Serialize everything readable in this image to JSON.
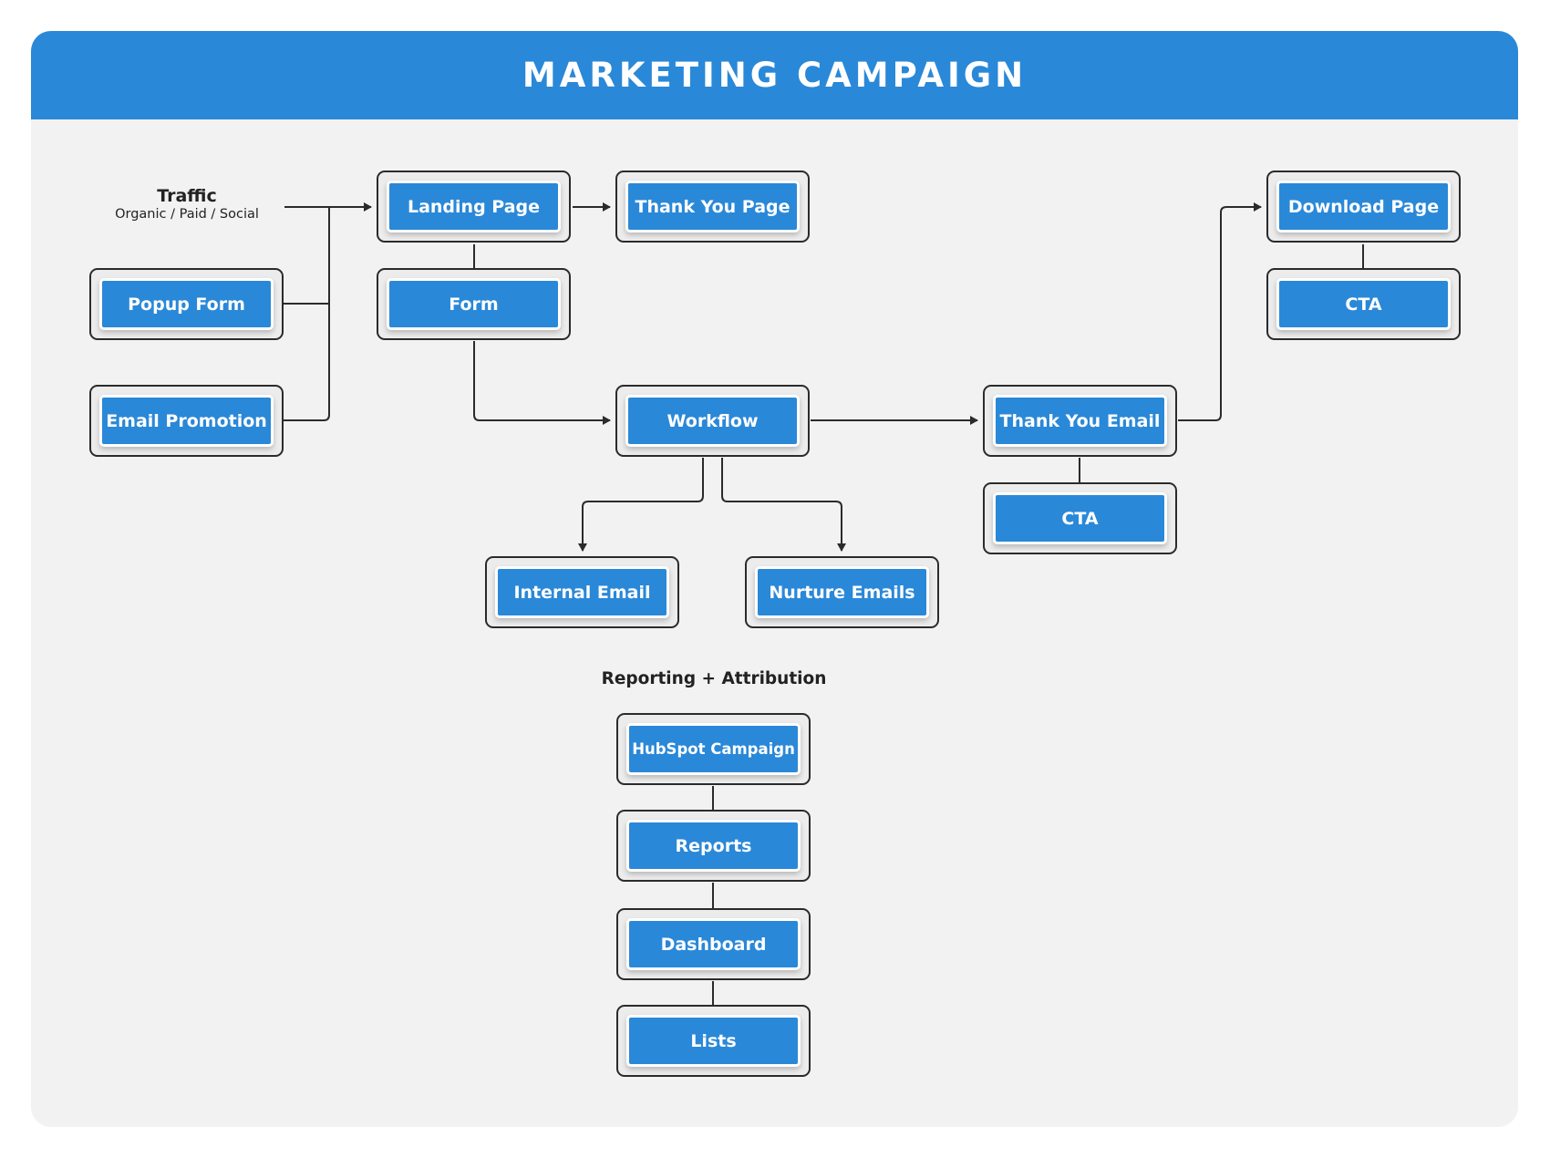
{
  "header": {
    "title": "MARKETING CAMPAIGN"
  },
  "traffic": {
    "title": "Traffic",
    "subtitle": "Organic / Paid / Social"
  },
  "reporting": {
    "label": "Reporting + Attribution"
  },
  "nodes": {
    "landing_page": "Landing Page",
    "thank_you_page": "Thank You Page",
    "popup_form": "Popup Form",
    "form": "Form",
    "email_promotion": "Email Promotion",
    "workflow": "Workflow",
    "thank_you_email": "Thank You Email",
    "cta_email": "CTA",
    "download_page": "Download Page",
    "cta_download": "CTA",
    "internal_email": "Internal Email",
    "nurture_emails": "Nurture Emails",
    "hubspot_campaign": "HubSpot Campaign",
    "reports": "Reports",
    "dashboard": "Dashboard",
    "lists": "Lists"
  },
  "edges": [
    {
      "from": "traffic",
      "to": "landing_page",
      "arrow": true
    },
    {
      "from": "popup_form",
      "to": "landing_page",
      "arrow": true
    },
    {
      "from": "email_promotion",
      "to": "landing_page",
      "arrow": true
    },
    {
      "from": "landing_page",
      "to": "thank_you_page",
      "arrow": true
    },
    {
      "from": "landing_page",
      "to": "form",
      "arrow": false
    },
    {
      "from": "form",
      "to": "workflow",
      "arrow": true
    },
    {
      "from": "workflow",
      "to": "thank_you_email",
      "arrow": true
    },
    {
      "from": "workflow",
      "to": "internal_email",
      "arrow": true
    },
    {
      "from": "workflow",
      "to": "nurture_emails",
      "arrow": true
    },
    {
      "from": "thank_you_email",
      "to": "cta_email",
      "arrow": false
    },
    {
      "from": "thank_you_email",
      "to": "download_page",
      "arrow": true
    },
    {
      "from": "download_page",
      "to": "cta_download",
      "arrow": false
    },
    {
      "from": "hubspot_campaign",
      "to": "reports",
      "arrow": false
    },
    {
      "from": "reports",
      "to": "dashboard",
      "arrow": false
    },
    {
      "from": "dashboard",
      "to": "lists",
      "arrow": false
    }
  ],
  "colors": {
    "accent": "#2a88d8",
    "panel": "#f2f2f2",
    "line": "#2b2b2b"
  }
}
